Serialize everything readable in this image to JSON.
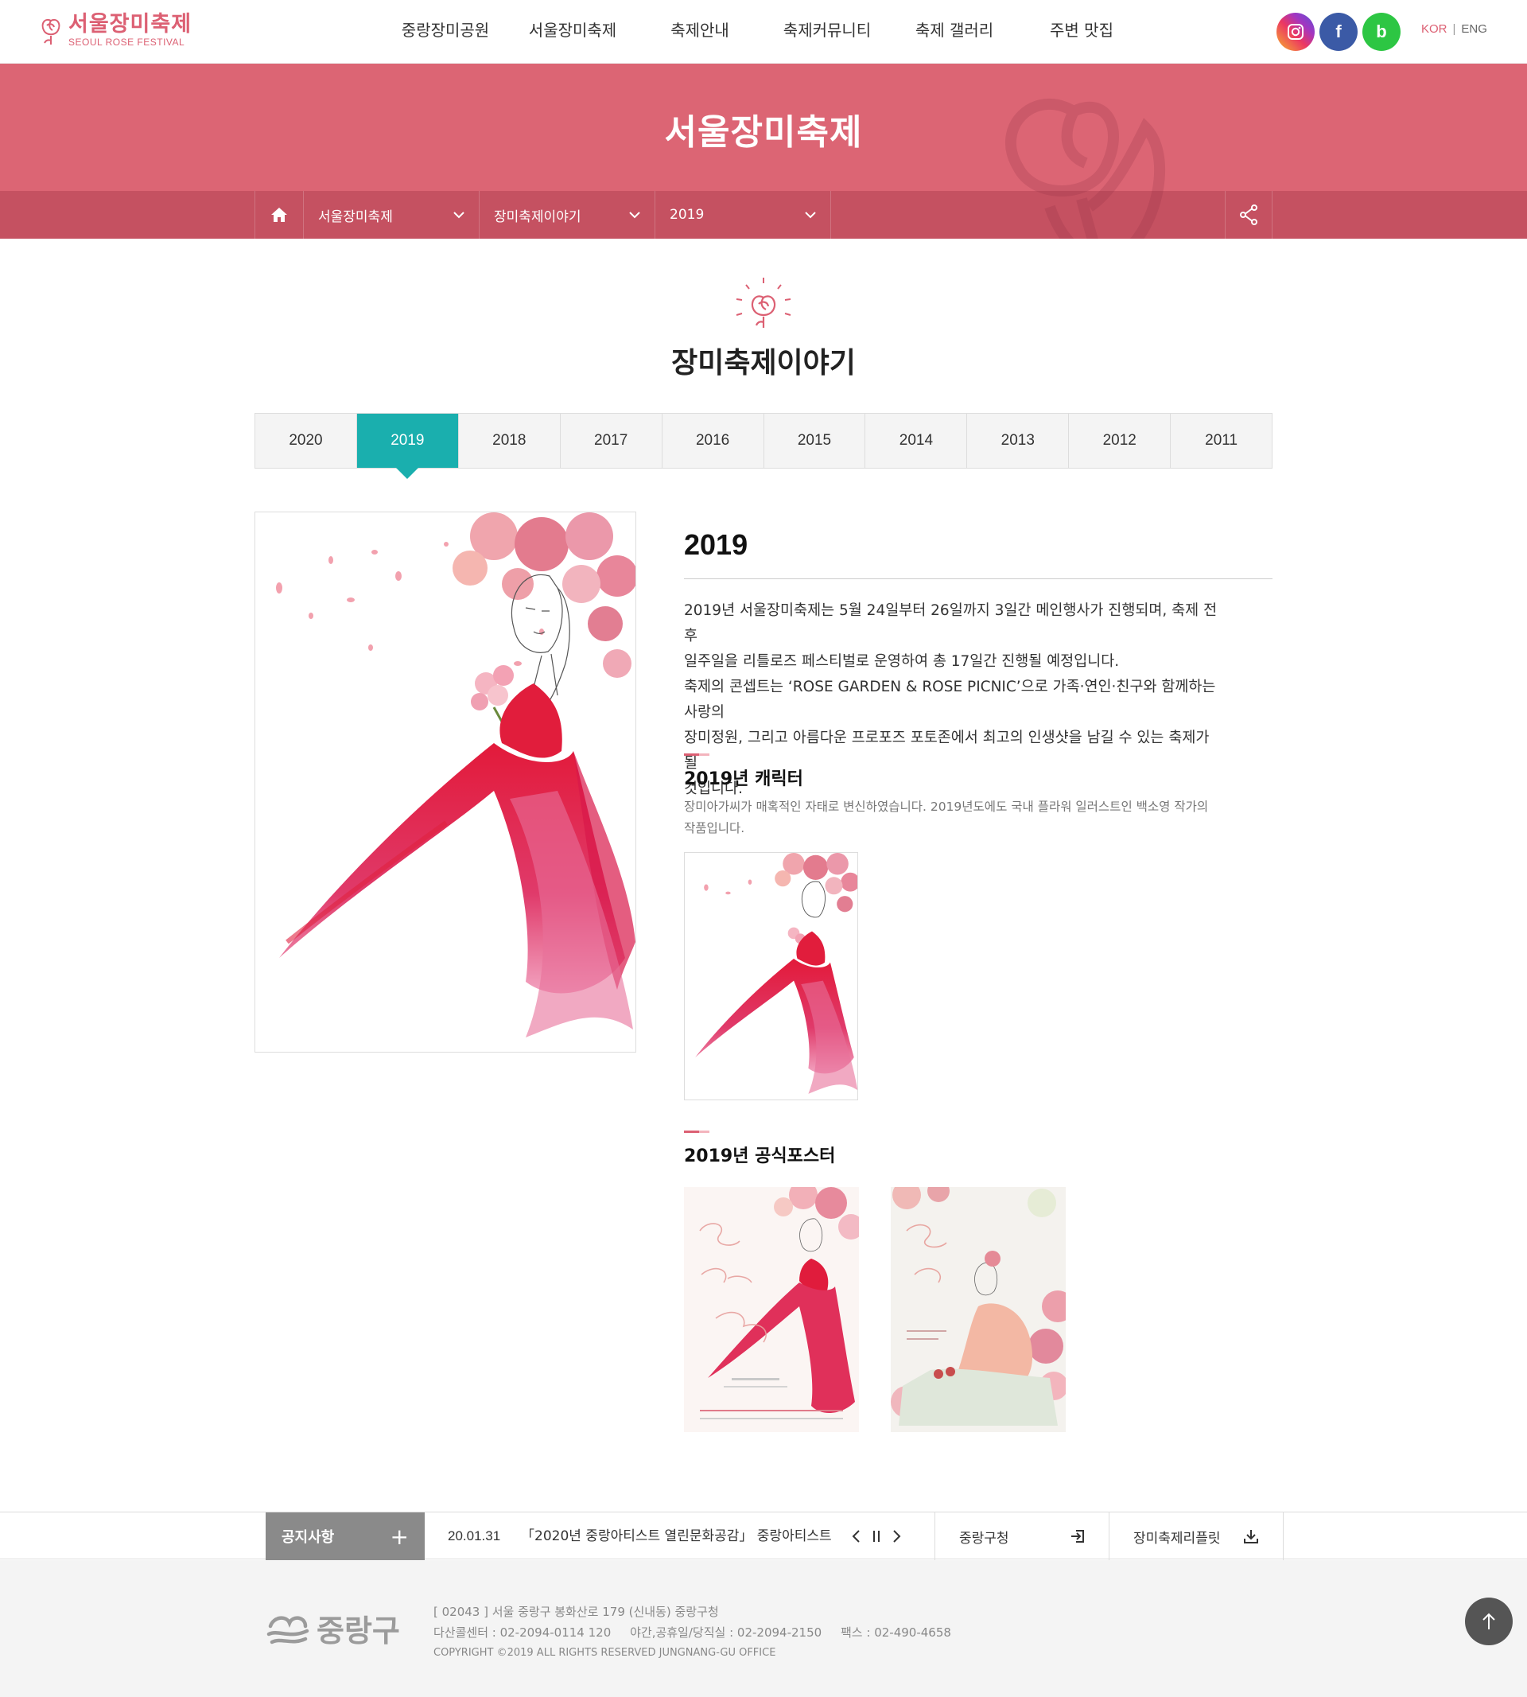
{
  "header": {
    "logo_ko": "서울장미축제",
    "logo_en": "SEOUL ROSE FESTIVAL",
    "nav": [
      "중랑장미공원",
      "서울장미축제",
      "축제안내",
      "축제커뮤니티",
      "축제 갤러리",
      "주변 맛집"
    ],
    "sns": {
      "instagram": "instagram-icon",
      "facebook": "f",
      "blog": "b"
    },
    "lang_kor": "KOR",
    "lang_sep": "|",
    "lang_eng": "ENG",
    "brand_color": "#dc6073"
  },
  "visual": {
    "title": "서울장미축제",
    "bg_color": "#dc6574",
    "location": {
      "home_icon": "home-icon",
      "selects": [
        "서울장미축제",
        "장미축제이야기",
        "2019"
      ],
      "share_icon": "share-icon"
    }
  },
  "content": {
    "page_title": "장미축제이야기",
    "tabs": [
      "2020",
      "2019",
      "2018",
      "2017",
      "2016",
      "2015",
      "2014",
      "2013",
      "2012",
      "2011"
    ],
    "active_tab": "2019",
    "accent_color": "#1aafae",
    "year": "2019",
    "desc": [
      "2019년 서울장미축제는 5월 24일부터 26일까지 3일간 메인행사가 진행되며, 축제 전후",
      "일주일을 리틀로즈 페스티벌로 운영하여 총 17일간 진행될 예정입니다.",
      "축제의 콘셉트는 ‘ROSE GARDEN & ROSE PICNIC’으로 가족·연인·친구와 함께하는 사랑의",
      "장미정원, 그리고 아름다운 프로포즈 포토존에서 최고의 인생샷을 남길 수 있는 축제가 될",
      "것입니다."
    ],
    "character_title": "2019년 캐릭터",
    "character_desc": [
      "장미아가씨가 매혹적인 자태로 변신하였습니다. 2019년도에도 국내 플라워 일러스트인 백소영 작가의",
      "작품입니다."
    ],
    "poster_title": "2019년 공식포스터"
  },
  "bottom_bar": {
    "notice_label": "공지사항",
    "notice_plus": "+",
    "notice_date": "20.01.31",
    "notice_text": "「2020년 중랑아티스트 열린문화공감」 중랑아티스트...",
    "quick1": "중랑구청",
    "quick2": "장미축제리플릿"
  },
  "footer": {
    "logo_text": "중랑구",
    "address": "[ 02043 ] 서울 중랑구 봉화산로 179 (신내동) 중랑구청",
    "contacts": "다산콜센터 : 02-2094-0114 120     야간,공휴일/당직실 : 02-2094-2150     팩스 : 02-490-4658",
    "copyright": "COPYRIGHT ©2019 ALL RIGHTS RESERVED JUNGNANG-GU OFFICE"
  }
}
